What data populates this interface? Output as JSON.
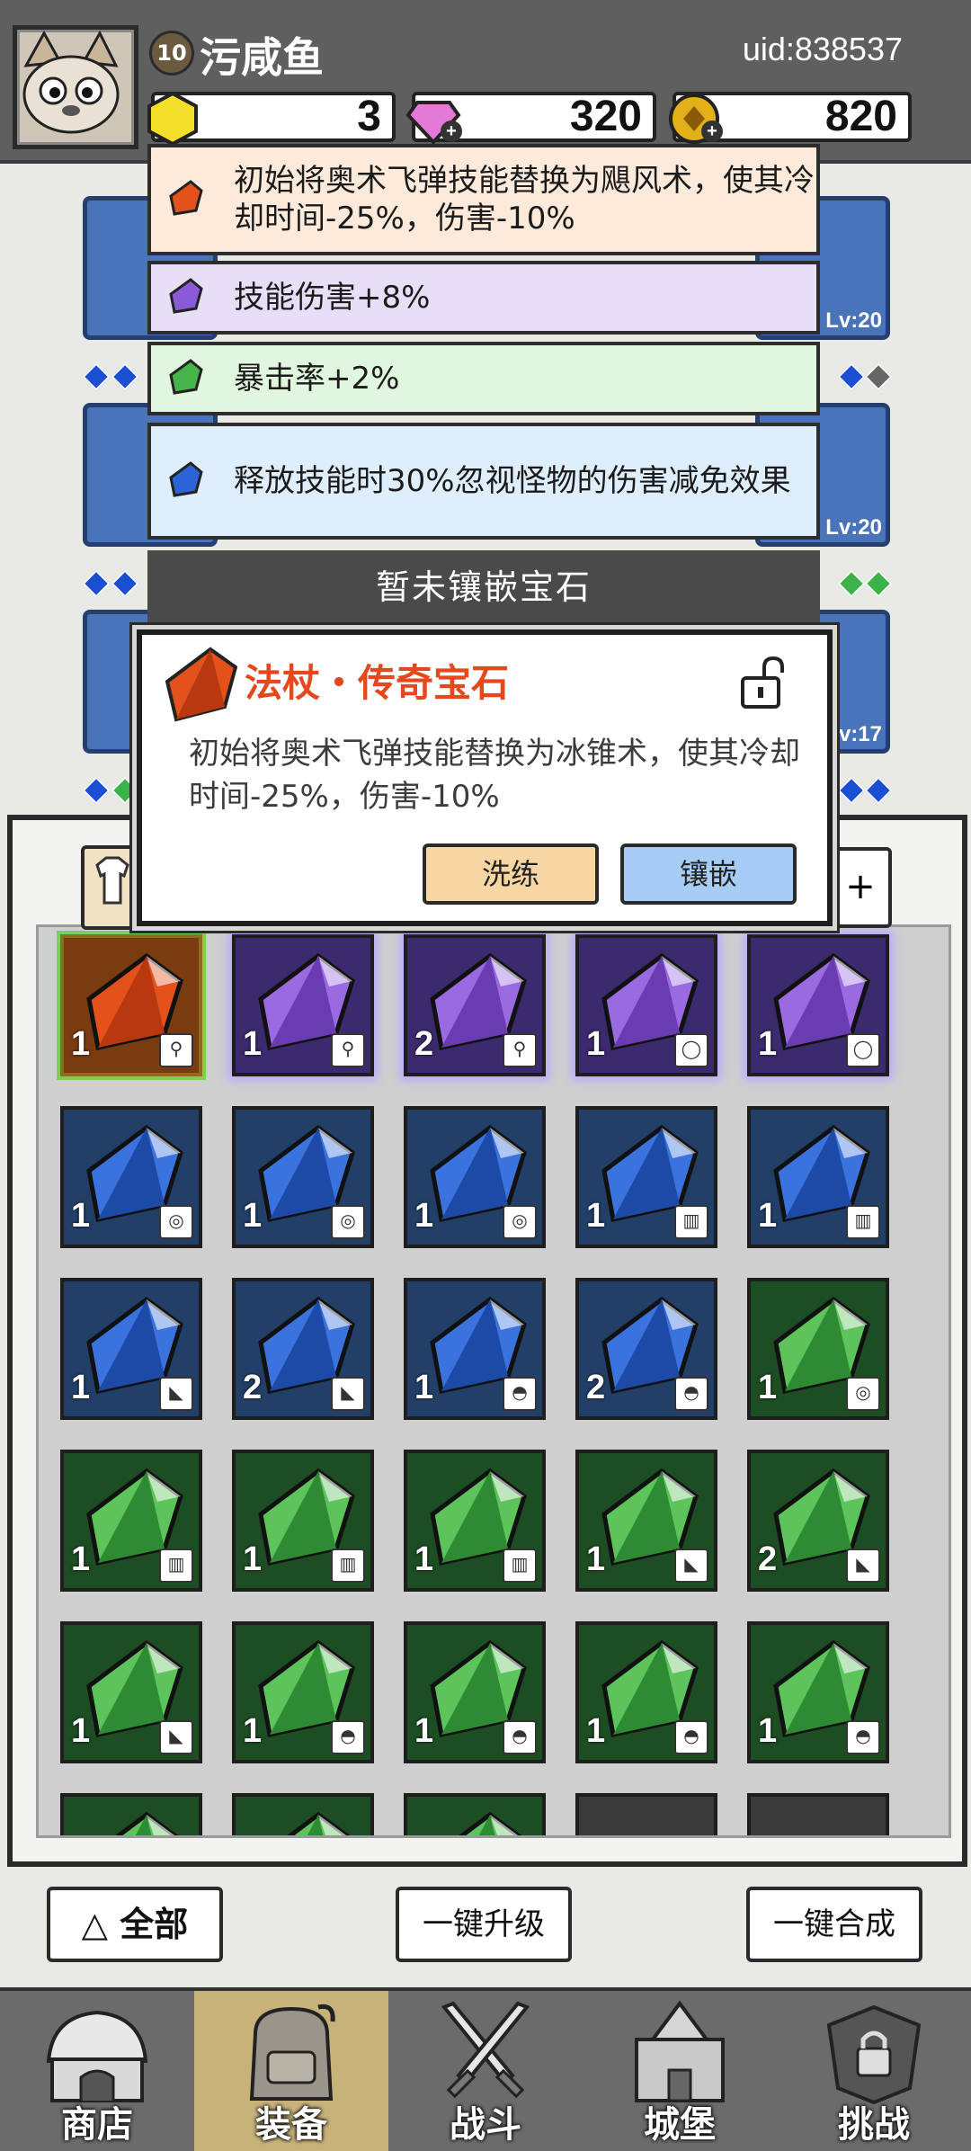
{
  "header": {
    "level": "10",
    "player_name": "污咸鱼",
    "uid": "uid:838537",
    "resources": [
      {
        "name": "hexagon-coin",
        "value": "3",
        "color": "#f3df2a"
      },
      {
        "name": "diamond",
        "value": "320",
        "color": "#e37bd6"
      },
      {
        "name": "gold-coin",
        "value": "820",
        "color": "#e2b018"
      }
    ]
  },
  "equipment_levels": [
    "Lv:20",
    "Lv:20",
    "Lv:17"
  ],
  "gem_effects": [
    {
      "text": "初始将奥术飞弹技能替换为飓风术，使其冷却时间-25%，伤害-10%",
      "gem": "orange",
      "bg": "#fdeadb"
    },
    {
      "text": "技能伤害+8%",
      "gem": "purple",
      "bg": "#e6dff7"
    },
    {
      "text": "暴击率+2%",
      "gem": "green",
      "bg": "#e0f6df"
    },
    {
      "text": "释放技能时30%忽视怪物的伤害减免效果",
      "gem": "blue",
      "bg": "#dfeefc"
    }
  ],
  "no_gem_label": "暂未镶嵌宝石",
  "popup": {
    "title": "法杖・传奇宝石",
    "description": "初始将奥术飞弹技能替换为冰锥术，使其冷却时间-25%，伤害-10%",
    "refine_label": "洗练",
    "inlay_label": "镶嵌"
  },
  "sort_tab_label": "+",
  "inventory": [
    {
      "color": "orange",
      "count": "1",
      "slot": "staff"
    },
    {
      "color": "purple",
      "count": "1",
      "slot": "staff"
    },
    {
      "color": "purple",
      "count": "2",
      "slot": "staff"
    },
    {
      "color": "purple",
      "count": "1",
      "slot": "ring"
    },
    {
      "color": "purple",
      "count": "1",
      "slot": "ring"
    },
    {
      "color": "blue",
      "count": "1",
      "slot": "amulet"
    },
    {
      "color": "blue",
      "count": "1",
      "slot": "amulet"
    },
    {
      "color": "blue",
      "count": "1",
      "slot": "amulet"
    },
    {
      "color": "blue",
      "count": "1",
      "slot": "armor"
    },
    {
      "color": "blue",
      "count": "1",
      "slot": "armor"
    },
    {
      "color": "blue",
      "count": "1",
      "slot": "boots"
    },
    {
      "color": "blue",
      "count": "2",
      "slot": "boots"
    },
    {
      "color": "blue",
      "count": "1",
      "slot": "helmet"
    },
    {
      "color": "blue",
      "count": "2",
      "slot": "helmet"
    },
    {
      "color": "green",
      "count": "1",
      "slot": "amulet"
    },
    {
      "color": "green",
      "count": "1",
      "slot": "armor"
    },
    {
      "color": "green",
      "count": "1",
      "slot": "armor"
    },
    {
      "color": "green",
      "count": "1",
      "slot": "armor"
    },
    {
      "color": "green",
      "count": "1",
      "slot": "boots"
    },
    {
      "color": "green",
      "count": "2",
      "slot": "boots"
    },
    {
      "color": "green",
      "count": "1",
      "slot": "boots"
    },
    {
      "color": "green",
      "count": "1",
      "slot": "helmet"
    },
    {
      "color": "green",
      "count": "1",
      "slot": "helmet"
    },
    {
      "color": "green",
      "count": "1",
      "slot": "helmet"
    },
    {
      "color": "green",
      "count": "1",
      "slot": "helmet"
    },
    {
      "color": "green",
      "count": "",
      "slot": ""
    },
    {
      "color": "green",
      "count": "",
      "slot": ""
    },
    {
      "color": "green",
      "count": "",
      "slot": ""
    },
    {
      "color": "dark",
      "count": "",
      "slot": ""
    },
    {
      "color": "dark",
      "count": "",
      "slot": ""
    }
  ],
  "actions": {
    "all_label": "全部",
    "upgrade_label": "一键升级",
    "merge_label": "一键合成"
  },
  "nav": [
    {
      "label": "商店",
      "icon": "shop-icon",
      "active": false
    },
    {
      "label": "装备",
      "icon": "backpack-icon",
      "active": true
    },
    {
      "label": "战斗",
      "icon": "crossed-swords-icon",
      "active": false
    },
    {
      "label": "城堡",
      "icon": "castle-icon",
      "active": false
    },
    {
      "label": "挑战",
      "icon": "locked-challenge-icon",
      "active": false
    }
  ]
}
